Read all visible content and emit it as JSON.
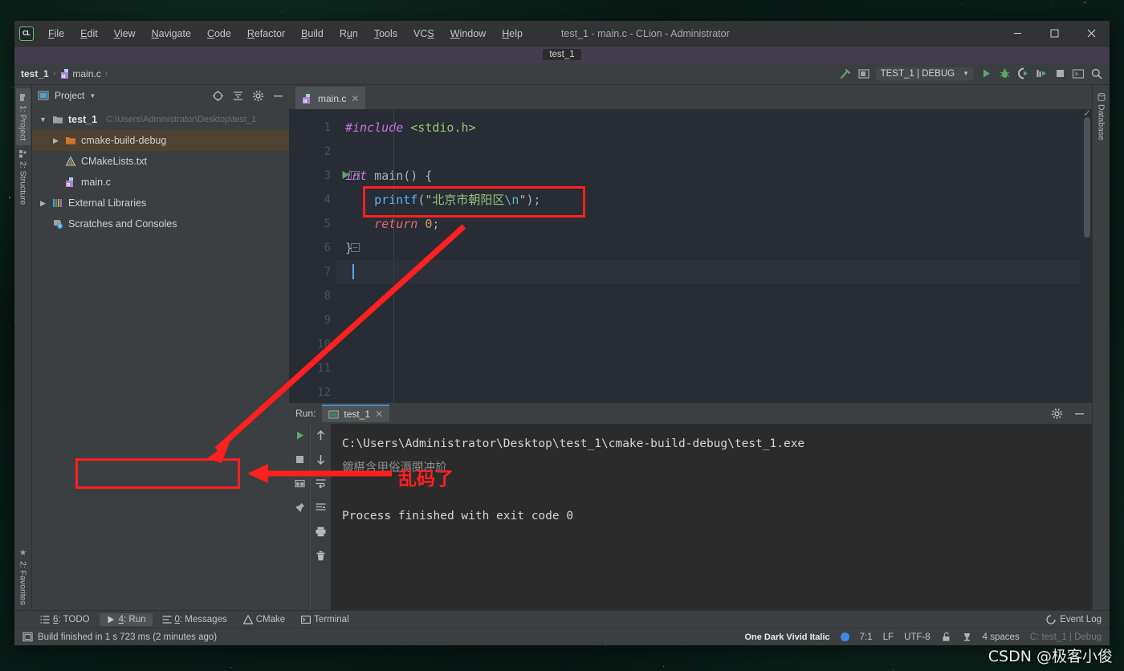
{
  "window": {
    "title": "test_1 - main.c - CLion - Administrator",
    "project_tab": "test_1",
    "minimize": "—",
    "maximize": "☐",
    "close": "✕"
  },
  "menu": [
    {
      "label": "File",
      "mnemonic": "F"
    },
    {
      "label": "Edit",
      "mnemonic": "E"
    },
    {
      "label": "View",
      "mnemonic": "V"
    },
    {
      "label": "Navigate",
      "mnemonic": "N"
    },
    {
      "label": "Code",
      "mnemonic": "C"
    },
    {
      "label": "Refactor",
      "mnemonic": "R"
    },
    {
      "label": "Build",
      "mnemonic": "B"
    },
    {
      "label": "Run",
      "mnemonic": "u"
    },
    {
      "label": "Tools",
      "mnemonic": "T"
    },
    {
      "label": "VCS",
      "mnemonic": "S"
    },
    {
      "label": "Window",
      "mnemonic": "W"
    },
    {
      "label": "Help",
      "mnemonic": "H"
    }
  ],
  "navbar": {
    "crumb1": "test_1",
    "crumb2": "main.c",
    "sep": "›",
    "run_config": "TEST_1 | DEBUG",
    "dropdown_caret": "▼"
  },
  "left_tool_tabs": [
    {
      "label": "1: Project",
      "mnemonic": "1"
    },
    {
      "label": "2: Structure",
      "mnemonic": "2"
    },
    {
      "label": "2: Favorites",
      "mnemonic": "2"
    }
  ],
  "right_tool_tabs": [
    {
      "label": "Database"
    }
  ],
  "project_panel": {
    "title": "Project",
    "caret": "▼",
    "tree": [
      {
        "arrow": "▼",
        "label": "test_1",
        "path": "C:\\Users\\Administrator\\Desktop\\test_1",
        "icon": "folder-icon",
        "selected": false,
        "indent": 0,
        "bold": true
      },
      {
        "arrow": "▶",
        "label": "cmake-build-debug",
        "path": "",
        "icon": "folder-orange-icon",
        "selected": true,
        "indent": 1,
        "bold": false
      },
      {
        "arrow": "",
        "label": "CMakeLists.txt",
        "path": "",
        "icon": "cmake-file-icon",
        "selected": false,
        "indent": 1,
        "bold": false
      },
      {
        "arrow": "",
        "label": "main.c",
        "path": "",
        "icon": "c-file-icon",
        "selected": false,
        "indent": 1,
        "bold": false
      },
      {
        "arrow": "▶",
        "label": "External Libraries",
        "path": "",
        "icon": "library-icon",
        "selected": false,
        "indent": 0,
        "bold": false
      },
      {
        "arrow": "",
        "label": "Scratches and Consoles",
        "path": "",
        "icon": "scratches-icon",
        "selected": false,
        "indent": 0,
        "bold": false
      }
    ]
  },
  "editor": {
    "tab_label": "main.c",
    "tab_close": "✕",
    "line_numbers": [
      "1",
      "2",
      "3",
      "4",
      "5",
      "6",
      "7",
      "8",
      "9",
      "10",
      "11",
      "12"
    ],
    "code_lines": [
      {
        "n": 1,
        "tokens": [
          {
            "t": "#include",
            "c": "inc"
          },
          {
            "t": " ",
            "c": "punc"
          },
          {
            "t": "<stdio.h>",
            "c": "hdr"
          }
        ]
      },
      {
        "n": 2,
        "tokens": []
      },
      {
        "n": 3,
        "tokens": [
          {
            "t": "int",
            "c": "kw"
          },
          {
            "t": " ",
            "c": "punc"
          },
          {
            "t": "main",
            "c": "punc"
          },
          {
            "t": "() {",
            "c": "punc"
          }
        ]
      },
      {
        "n": 4,
        "tokens": [
          {
            "t": "    ",
            "c": "punc"
          },
          {
            "t": "printf",
            "c": "fn"
          },
          {
            "t": "(",
            "c": "punc"
          },
          {
            "t": "\"北京市朝阳区",
            "c": "str"
          },
          {
            "t": "\\n",
            "c": "esc"
          },
          {
            "t": "\"",
            "c": "str"
          },
          {
            "t": ");",
            "c": "punc"
          }
        ]
      },
      {
        "n": 5,
        "tokens": [
          {
            "t": "    ",
            "c": "punc"
          },
          {
            "t": "return",
            "c": "kw2"
          },
          {
            "t": " ",
            "c": "punc"
          },
          {
            "t": "0",
            "c": "num"
          },
          {
            "t": ";",
            "c": "punc"
          }
        ]
      },
      {
        "n": 6,
        "tokens": [
          {
            "t": "}",
            "c": "punc"
          }
        ]
      },
      {
        "n": 7,
        "tokens": []
      },
      {
        "n": 8,
        "tokens": []
      },
      {
        "n": 9,
        "tokens": []
      },
      {
        "n": 10,
        "tokens": []
      },
      {
        "n": 11,
        "tokens": []
      },
      {
        "n": 12,
        "tokens": []
      }
    ]
  },
  "run_window": {
    "label": "Run:",
    "tab_label": "test_1",
    "tab_close": "✕",
    "console_lines": [
      {
        "text": "C:\\Users\\Administrator\\Desktop\\test_1\\cmake-build-debug\\test_1.exe",
        "style": "normal"
      },
      {
        "text": "鍍椹含甲俗溽閱冲斺",
        "style": "mojibake"
      },
      {
        "text": "",
        "style": "normal"
      },
      {
        "text": "Process finished with exit code 0",
        "style": "normal"
      }
    ]
  },
  "annotations": {
    "garbled_label": "乱码了"
  },
  "bottom_tabs": [
    {
      "label": "6: TODO",
      "mnemonic": "6",
      "icon": "todo-icon",
      "active": false
    },
    {
      "label": "4: Run",
      "mnemonic": "4",
      "icon": "run-icon",
      "active": true
    },
    {
      "label": "0: Messages",
      "mnemonic": "0",
      "icon": "messages-icon",
      "active": false
    },
    {
      "label": "CMake",
      "mnemonic": "",
      "icon": "cmake-icon",
      "active": false
    },
    {
      "label": "Terminal",
      "mnemonic": "",
      "icon": "terminal-icon",
      "active": false
    }
  ],
  "event_log": "Event Log",
  "status_bar": {
    "build_message": "Build finished in 1 s 723 ms (2 minutes ago)",
    "color_scheme": "One Dark Vivid Italic",
    "caret_position": "7:1",
    "line_separator": "LF",
    "encoding": "UTF-8",
    "indent": "4 spaces",
    "toolchain": "C: test_1 | Debug"
  },
  "watermark": "CSDN @极客小俊",
  "colors": {
    "accent_red": "#ff1f1f",
    "accent_green": "#59a869",
    "accent_blue": "#4a88c7",
    "selection": "#4e4233",
    "editor_bg": "#282c34",
    "panel_bg": "#3c3f41"
  }
}
